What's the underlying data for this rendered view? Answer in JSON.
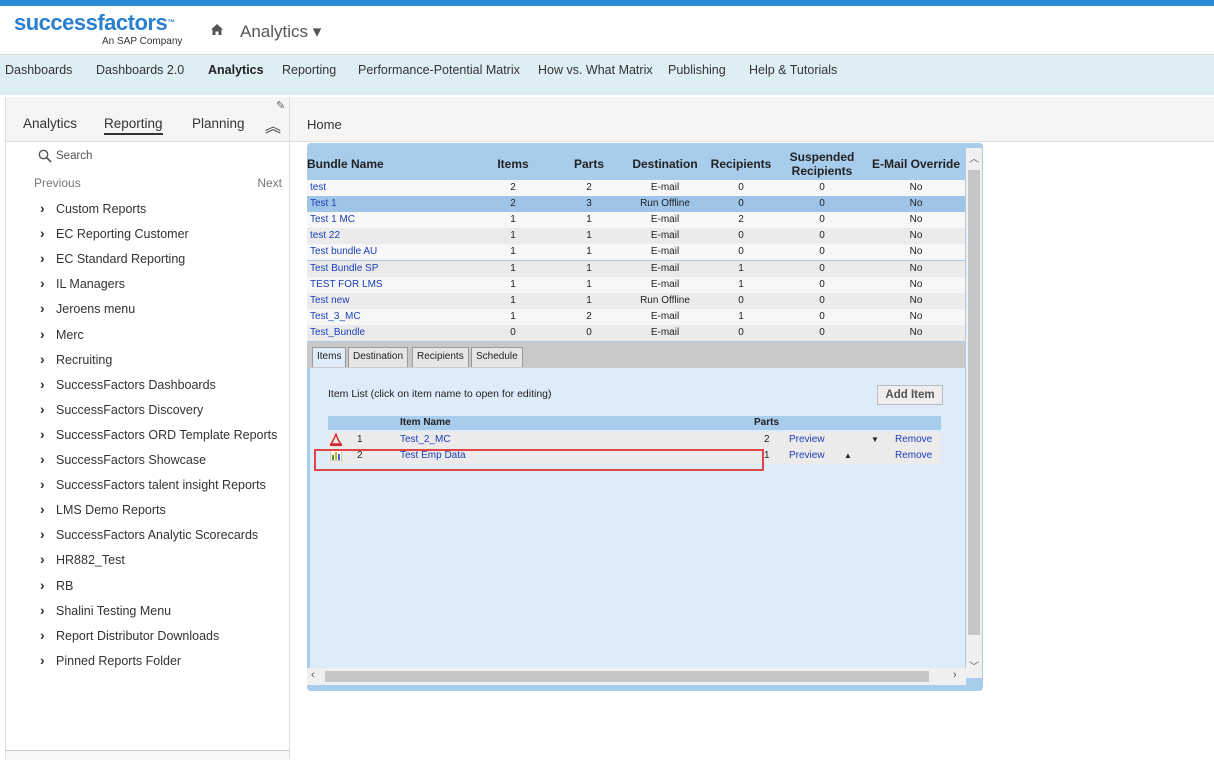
{
  "brand": {
    "name": "successfactors",
    "tm": "™",
    "subtitle": "An SAP Company"
  },
  "header": {
    "module": "Analytics ▾"
  },
  "nav": [
    "Dashboards",
    "Dashboards 2.0",
    "Analytics",
    "Reporting",
    "Performance-Potential Matrix",
    "How vs. What Matrix",
    "Publishing",
    "Help & Tutorials"
  ],
  "nav_active": "Analytics",
  "sidebar": {
    "tabs": [
      "Analytics",
      "Reporting",
      "Planning"
    ],
    "active_tab": "Reporting",
    "search_placeholder": "Search",
    "previous": "Previous",
    "next": "Next",
    "folders": [
      "Custom Reports",
      "EC Reporting Customer",
      "EC Standard Reporting",
      "IL Managers",
      "Jeroens menu",
      "Merc",
      "Recruiting",
      "SuccessFactors Dashboards",
      "SuccessFactors Discovery",
      "SuccessFactors ORD Template Reports",
      "SuccessFactors Showcase",
      "SuccessFactors talent insight Reports",
      "LMS Demo Reports",
      "SuccessFactors Analytic Scorecards",
      "HR882_Test",
      "RB",
      "Shalini Testing Menu",
      "Report Distributor Downloads",
      "Pinned Reports Folder"
    ]
  },
  "breadcrumb": "Home",
  "bundles": {
    "columns": [
      "Bundle Name",
      "Items",
      "Parts",
      "Destination",
      "Recipients",
      "Suspended Recipients",
      "E-Mail Override"
    ],
    "rows": [
      [
        "test",
        "2",
        "2",
        "E-mail",
        "0",
        "0",
        "No"
      ],
      [
        "Test 1",
        "2",
        "3",
        "Run Offline",
        "0",
        "0",
        "No"
      ],
      [
        "Test 1 MC",
        "1",
        "1",
        "E-mail",
        "2",
        "0",
        "No"
      ],
      [
        "test 22",
        "1",
        "1",
        "E-mail",
        "0",
        "0",
        "No"
      ],
      [
        "Test bundle AU",
        "1",
        "1",
        "E-mail",
        "0",
        "0",
        "No"
      ],
      [
        "Test Bundle SP",
        "1",
        "1",
        "E-mail",
        "1",
        "0",
        "No"
      ],
      [
        "TEST FOR LMS",
        "1",
        "1",
        "E-mail",
        "1",
        "0",
        "No"
      ],
      [
        "Test new",
        "1",
        "1",
        "Run Offline",
        "0",
        "0",
        "No"
      ],
      [
        "Test_3_MC",
        "1",
        "2",
        "E-mail",
        "1",
        "0",
        "No"
      ],
      [
        "Test_Bundle",
        "0",
        "0",
        "E-mail",
        "0",
        "0",
        "No"
      ]
    ],
    "selected_row": 1
  },
  "detail_tabs": [
    "Items",
    "Destination",
    "Recipients",
    "Schedule"
  ],
  "active_detail_tab": "Items",
  "items": {
    "title": "Item List (click on item name to open for editing)",
    "add_button": "Add Item",
    "col_name": "Item Name",
    "col_parts": "Parts",
    "rows": [
      {
        "num": "1",
        "name": "Test_2_MC",
        "parts": "2",
        "preview": "Preview",
        "remove": "Remove",
        "icon": "pdf-icon",
        "move": "▼"
      },
      {
        "num": "2",
        "name": "Test Emp Data",
        "parts": "1",
        "preview": "Preview",
        "remove": "Remove",
        "icon": "chart-icon",
        "move": "▲"
      }
    ]
  },
  "colors": {
    "accent": "#2a8ad4",
    "highlight": "#e04545",
    "link": "#1a3eb8"
  }
}
